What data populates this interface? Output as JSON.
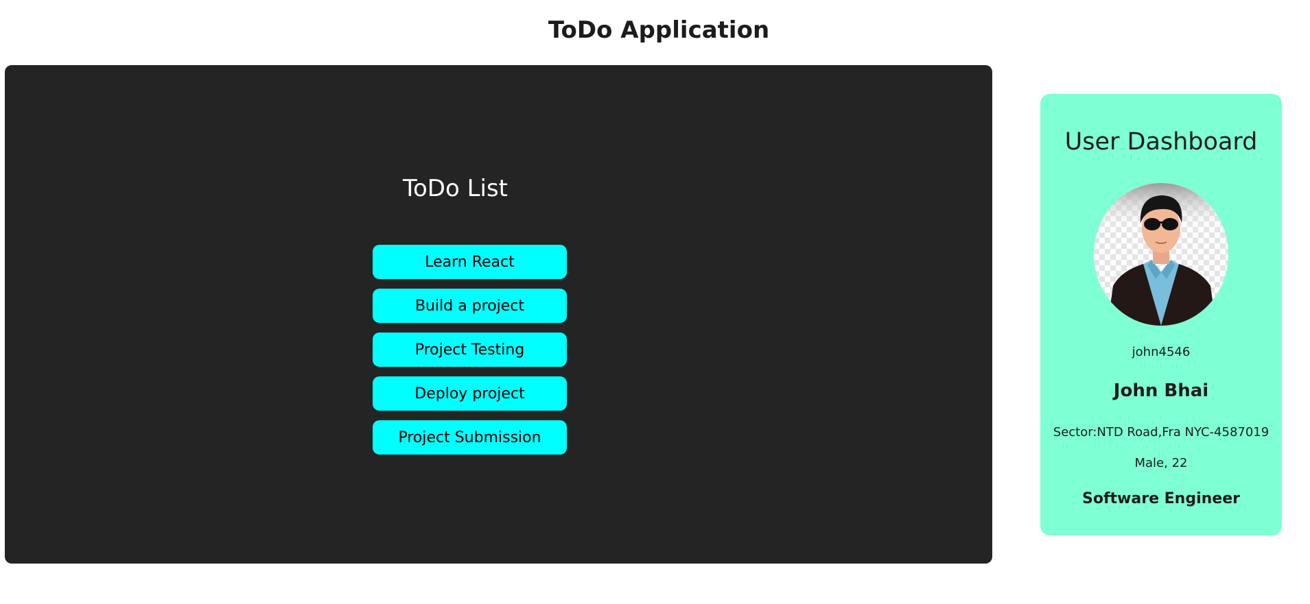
{
  "app": {
    "title": "ToDo Application"
  },
  "todo": {
    "heading": "ToDo List",
    "items": [
      {
        "label": "Learn React"
      },
      {
        "label": "Build a project"
      },
      {
        "label": "Project Testing"
      },
      {
        "label": "Deploy project"
      },
      {
        "label": "Project Submission"
      }
    ]
  },
  "user": {
    "card_title": "User Dashboard",
    "avatar_icon": "user-avatar-icon",
    "username": "john4546",
    "full_name": "John Bhai",
    "address": "Sector:NTD Road,Fra NYC-4587019",
    "gender_age": "Male, 22",
    "profession": "Software Engineer"
  },
  "colors": {
    "panel_bg": "#242424",
    "todo_item_bg": "#00ffff",
    "card_bg": "#7fffd4"
  }
}
